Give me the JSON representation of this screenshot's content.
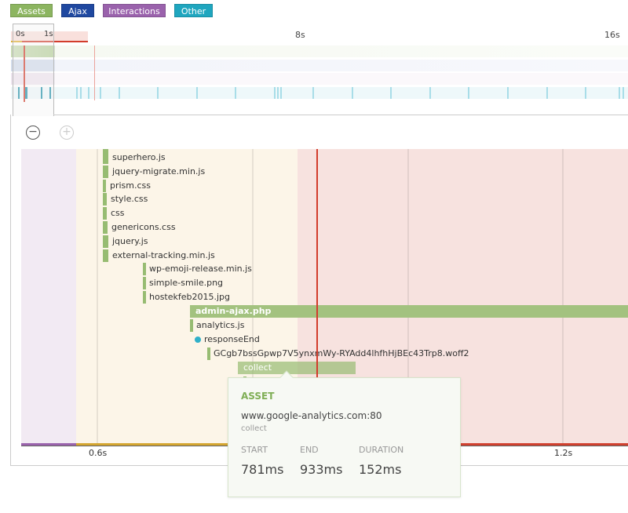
{
  "legend": [
    {
      "label": "Assets",
      "color": "#8cb560"
    },
    {
      "label": "Ajax",
      "color": "#1f48a0"
    },
    {
      "label": "Interactions",
      "color": "#9a62ac"
    },
    {
      "label": "Other",
      "color": "#1fa6bf"
    }
  ],
  "overview": {
    "ticks": [
      "0s",
      "1s",
      "8s",
      "16s"
    ]
  },
  "zoom": {
    "out_label": "−",
    "in_label": "+"
  },
  "axis": {
    "ticks": [
      "0.6s",
      "1.2s"
    ]
  },
  "rows": [
    {
      "label": "superhero.js",
      "type": "asset"
    },
    {
      "label": "jquery-migrate.min.js",
      "type": "asset"
    },
    {
      "label": "prism.css",
      "type": "asset"
    },
    {
      "label": "style.css",
      "type": "asset"
    },
    {
      "label": "css",
      "type": "asset"
    },
    {
      "label": "genericons.css",
      "type": "asset"
    },
    {
      "label": "jquery.js",
      "type": "asset"
    },
    {
      "label": "external-tracking.min.js",
      "type": "asset"
    },
    {
      "label": "wp-emoji-release.min.js",
      "type": "asset"
    },
    {
      "label": "simple-smile.png",
      "type": "asset"
    },
    {
      "label": "hostekfeb2015.jpg",
      "type": "asset"
    },
    {
      "label": "admin-ajax.php",
      "type": "asset"
    },
    {
      "label": "analytics.js",
      "type": "asset"
    },
    {
      "label": "responseEnd",
      "type": "event"
    },
    {
      "label": "GCgb7bssGpwp7V5ynxmWy-RYAdd4lhfhHjBEc43Trp8.woff2",
      "type": "asset"
    },
    {
      "label": "collect",
      "type": "asset"
    }
  ],
  "tooltip": {
    "type": "ASSET",
    "host": "www.google-analytics.com:80",
    "name": "collect",
    "start_label": "START",
    "end_label": "END",
    "duration_label": "DURATION",
    "start": "781ms",
    "end": "933ms",
    "duration": "152ms"
  }
}
